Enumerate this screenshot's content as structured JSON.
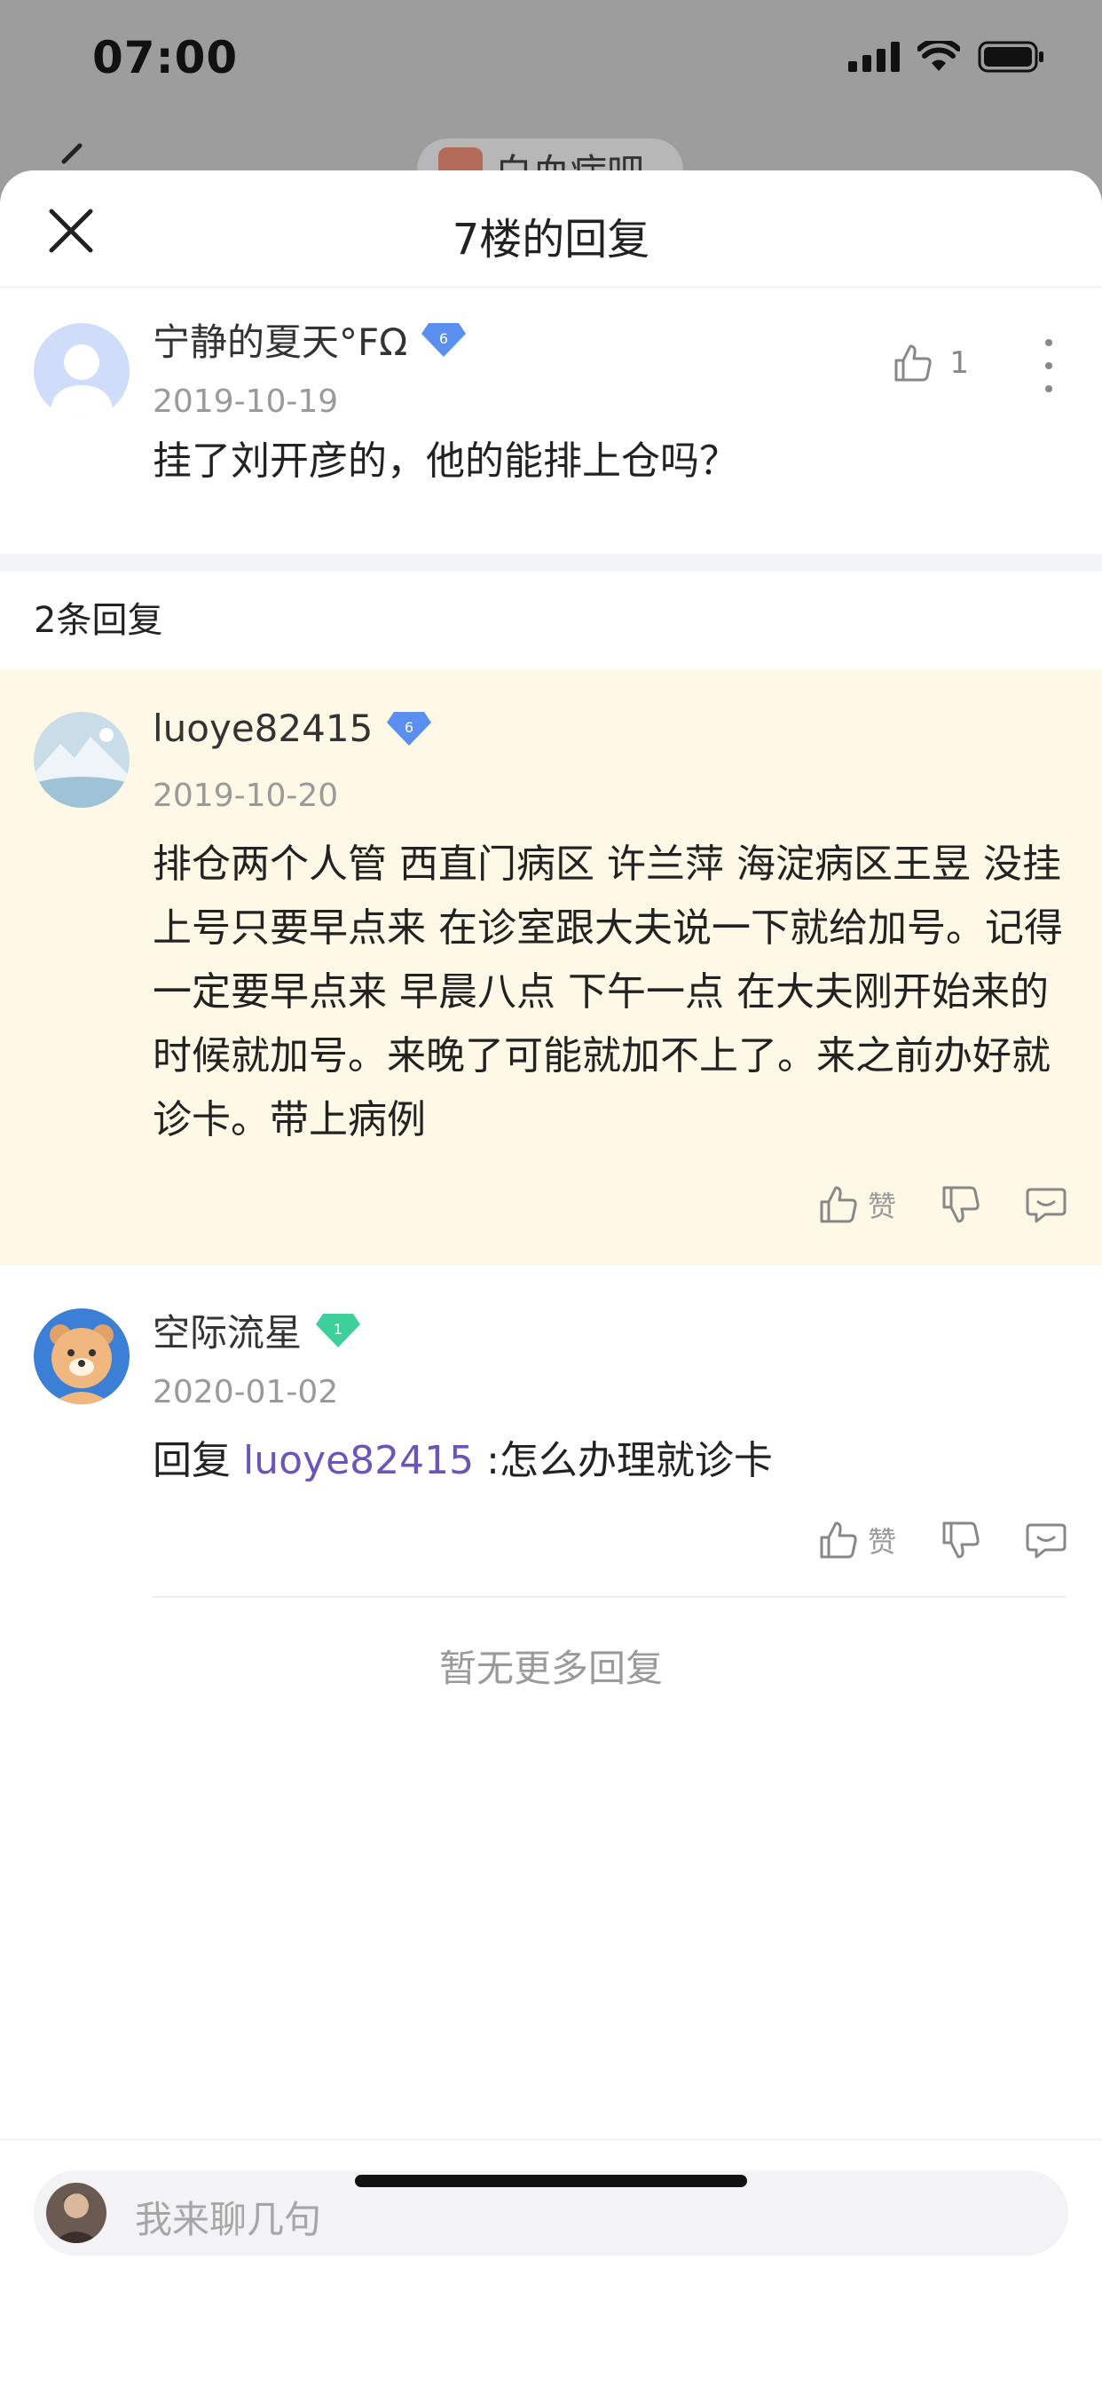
{
  "status": {
    "time": "07:00"
  },
  "backdrop": {
    "title": "白血病吧"
  },
  "sheet": {
    "title": "7楼的回复"
  },
  "post": {
    "username": "宁静的夏天°FΩ",
    "badge_level": "6",
    "date": "2019-10-19",
    "content": "挂了刘开彦的，他的能排上仓吗？",
    "like_count": "1"
  },
  "reply_count_label": "2条回复",
  "replies": [
    {
      "username": "luoye82415",
      "badge_level": "6",
      "date": "2019-10-20",
      "content": "排仓两个人管 西直门病区 许兰萍 海淀病区王昱 没挂上号只要早点来 在诊室跟大夫说一下就给加号。记得一定要早点来 早晨八点 下午一点 在大夫刚开始来的时候就加号。来晚了可能就加不上了。来之前办好就诊卡。带上病例",
      "like_label": "赞"
    },
    {
      "username": "空际流星",
      "badge_level": "1",
      "date": "2020-01-02",
      "reply_prefix": "回复 ",
      "reply_to": "luoye82415",
      "content": " :怎么办理就诊卡",
      "like_label": "赞"
    }
  ],
  "no_more_label": "暂无更多回复",
  "input": {
    "placeholder": "我来聊几句"
  },
  "colors": {
    "badge_blue": "#5a8ff0",
    "badge_green": "#3fcf9a",
    "highlight_bg": "#fdf9e6",
    "link": "#6a55b8"
  }
}
